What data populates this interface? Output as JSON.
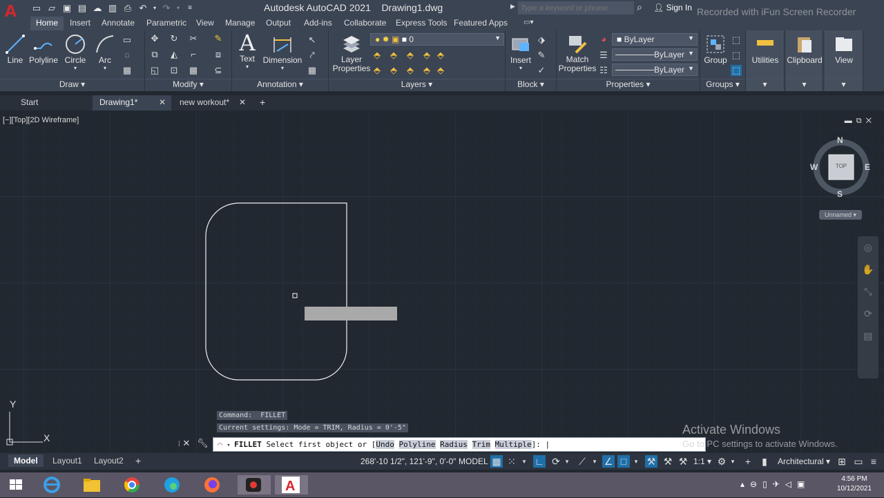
{
  "titlebar": {
    "app_logo": "A",
    "title": "Autodesk AutoCAD 2021    Drawing1.dwg",
    "search_placeholder": "Type a keyword or phrase",
    "sign_in": "Sign In",
    "watermark": "Recorded with iFun Screen Recorder"
  },
  "ribbon_tabs": [
    "Home",
    "Insert",
    "Annotate",
    "Parametric",
    "View",
    "Manage",
    "Output",
    "Add-ins",
    "Collaborate",
    "Express Tools",
    "Featured Apps"
  ],
  "ribbon": {
    "draw": {
      "title": "Draw",
      "line": "Line",
      "polyline": "Polyline",
      "circle": "Circle",
      "arc": "Arc"
    },
    "modify": {
      "title": "Modify"
    },
    "annotation": {
      "title": "Annotation",
      "text": "Text",
      "dimension": "Dimension"
    },
    "layers": {
      "title": "Layers",
      "layer_properties": "Layer\nProperties",
      "current_layer": "0"
    },
    "block": {
      "title": "Block",
      "insert": "Insert"
    },
    "properties": {
      "title": "Properties",
      "match": "Match\nProperties",
      "color": "ByLayer",
      "linetype": "ByLayer",
      "lineweight": "ByLayer"
    },
    "groups": {
      "title": "Groups",
      "group": "Group"
    },
    "utilities": "Utilities",
    "clipboard": "Clipboard",
    "view": "View"
  },
  "doc_tabs": [
    {
      "label": "Start"
    },
    {
      "label": "Drawing1*"
    },
    {
      "label": "new workout*"
    }
  ],
  "viewport": {
    "label": "[−][Top][2D Wireframe]",
    "viewcube": {
      "north": "N",
      "south": "S",
      "east": "E",
      "west": "W",
      "face": "TOP"
    },
    "ucs": "Unnamed",
    "axis_x": "X",
    "axis_y": "Y"
  },
  "command": {
    "history": [
      "Command:  FILLET",
      "Current settings: Mode = TRIM, Radius = 0'-5\""
    ],
    "prompt_cmd": "FILLET",
    "prompt_text": "Select first object or [",
    "options": [
      "Undo",
      "Polyline",
      "Radius",
      "Trim",
      "Multiple"
    ],
    "prompt_end": "]:"
  },
  "activate_windows": {
    "title": "Activate Windows",
    "subtitle": "Go to PC settings to activate Windows."
  },
  "statusbar": {
    "layouts": [
      "Model",
      "Layout1",
      "Layout2"
    ],
    "coords": "268'-10 1/2\", 121'-9\", 0'-0\"",
    "model": "MODEL",
    "scale": "1:1",
    "units": "Architectural"
  },
  "taskbar": {
    "time": "4:56 PM",
    "date": "10/12/2021"
  }
}
